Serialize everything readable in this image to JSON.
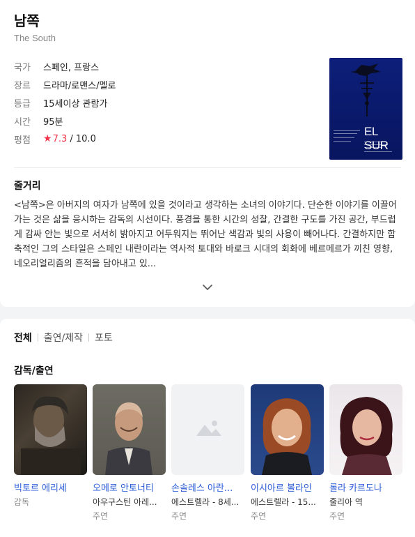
{
  "movie": {
    "title": "남쪽",
    "original_title": "The South",
    "info": [
      {
        "label": "국가",
        "value": "스페인, 프랑스"
      },
      {
        "label": "장르",
        "value": "드라마/로맨스/멜로"
      },
      {
        "label": "등급",
        "value": "15세이상 관람가"
      },
      {
        "label": "시간",
        "value": "95분"
      }
    ],
    "rating": {
      "label": "평점",
      "score": "7.3",
      "max": " / 10.0"
    },
    "poster_title": "EL SUR"
  },
  "synopsis": {
    "heading": "줄거리",
    "text": "<남쪽>은 아버지의 여자가 남쪽에 있을 것이라고 생각하는 소녀의 이야기다. 단순한 이야기를 이끌어가는 것은 삶을 응시하는 감독의 시선이다. 풍경을 통한 시간의 성찰, 간결한 구도를 가진 공간, 부드럽게 감싸 안는 빛으로 서서히 밝아지고 어두워지는 뛰어난 색감과 빛의 사용이 빼어나다. 간결하지만 함축적인 그의 스타일은 스페인 내란이라는 역사적 토대와 바로크 시대의 회화에 베르메르가 끼친 영향, 네오리얼리즘의 흔적을 담아내고 있..."
  },
  "tabs": [
    "전체",
    "출연/제작",
    "포토"
  ],
  "cast_heading": "감독/출연",
  "cast": [
    {
      "name": "빅토르 에리세",
      "role": "",
      "type": "감독"
    },
    {
      "name": "오메로 안토너티",
      "role": "아우구스틴 아레...",
      "type": "주연"
    },
    {
      "name": "손솔레스 아란...",
      "role": "에스트렐라 - 8세...",
      "type": "주연"
    },
    {
      "name": "이시아르 볼라인",
      "role": "에스트렐라 - 15...",
      "type": "주연"
    },
    {
      "name": "롤라 카르도나",
      "role": "줄리아 역",
      "type": "주연"
    }
  ],
  "colors": {
    "accent": "#f0334a",
    "link": "#2a5bd7",
    "poster_bg": "#0d1f7a"
  },
  "icons": {
    "expand": "chevron-down-icon",
    "star": "star-icon",
    "placeholder": "image-placeholder-icon"
  }
}
